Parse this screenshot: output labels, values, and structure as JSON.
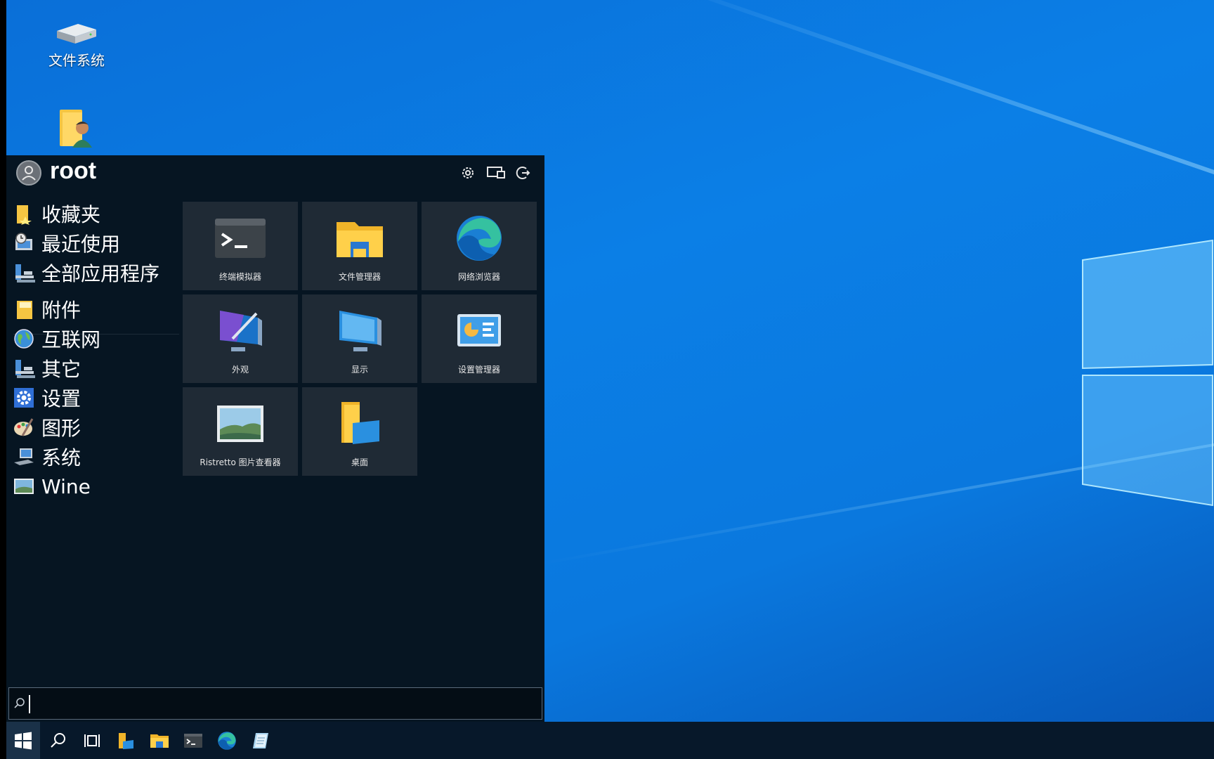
{
  "desktop": {
    "icons": [
      {
        "label": "文件系统",
        "icon": "drive-icon"
      },
      {
        "label": "",
        "icon": "user-folder-icon"
      }
    ]
  },
  "start_menu": {
    "user": {
      "name": "root"
    },
    "header_buttons": [
      "settings-icon",
      "display-icon",
      "logout-icon"
    ],
    "categories": [
      {
        "label": "收藏夹",
        "icon": "favorites-folder-icon"
      },
      {
        "label": "最近使用",
        "icon": "recent-icon"
      },
      {
        "label": "全部应用程序",
        "icon": "all-apps-icon"
      },
      {
        "label": "附件",
        "icon": "accessories-icon"
      },
      {
        "label": "互联网",
        "icon": "internet-globe-icon"
      },
      {
        "label": "其它",
        "icon": "other-icon"
      },
      {
        "label": "设置",
        "icon": "settings-gear-icon"
      },
      {
        "label": "图形",
        "icon": "graphics-palette-icon"
      },
      {
        "label": "系统",
        "icon": "system-icon"
      },
      {
        "label": "Wine",
        "icon": "wine-icon"
      }
    ],
    "tiles": [
      {
        "label": "终端模拟器",
        "icon": "terminal-icon"
      },
      {
        "label": "文件管理器",
        "icon": "file-manager-icon"
      },
      {
        "label": "网络浏览器",
        "icon": "web-browser-icon"
      },
      {
        "label": "外观",
        "icon": "appearance-icon"
      },
      {
        "label": "显示",
        "icon": "display-monitor-icon"
      },
      {
        "label": "设置管理器",
        "icon": "settings-manager-icon"
      },
      {
        "label": "Ristretto 图片查看器",
        "icon": "image-viewer-icon"
      },
      {
        "label": "桌面",
        "icon": "desktop-folder-icon"
      }
    ],
    "search": {
      "value": "",
      "placeholder": ""
    }
  },
  "taskbar": {
    "items": [
      "start-icon",
      "search-icon",
      "task-view-icon",
      "files-icon",
      "file-explorer-icon",
      "terminal-icon",
      "edge-icon",
      "notepad-icon"
    ]
  },
  "colors": {
    "desktop_blue": "#0a78de",
    "menu_bg": "#061522",
    "tile_bg": "#1f2a35",
    "taskbar_bg": "#07182a"
  }
}
